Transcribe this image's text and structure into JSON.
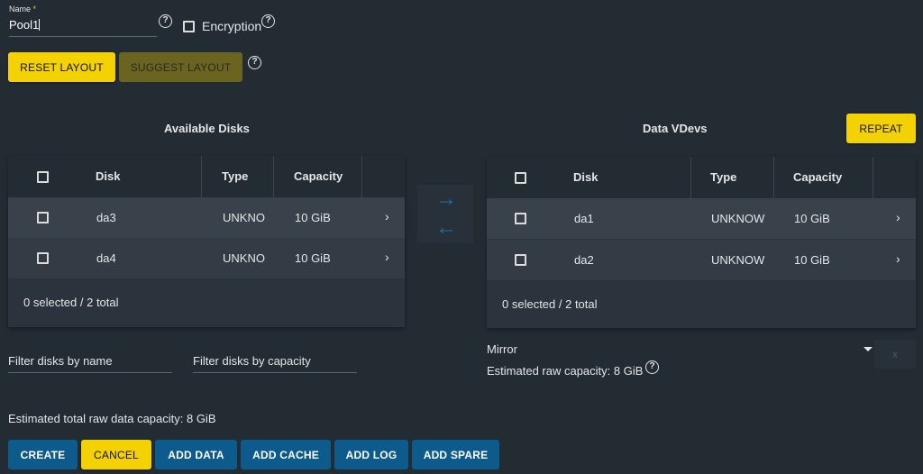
{
  "name_field": {
    "label": "Name",
    "required_mark": "*",
    "value": "Pool1"
  },
  "encryption": {
    "label": "Encryption"
  },
  "help_glyph": "?",
  "layout_buttons": {
    "reset": "RESET LAYOUT",
    "suggest": "SUGGEST LAYOUT"
  },
  "available": {
    "title": "Available Disks",
    "headers": {
      "disk": "Disk",
      "type": "Type",
      "capacity": "Capacity"
    },
    "rows": [
      {
        "disk": "da3",
        "type": "UNKNO",
        "capacity": "10 GiB"
      },
      {
        "disk": "da4",
        "type": "UNKNO",
        "capacity": "10 GiB"
      }
    ],
    "footer": "0 selected / 2 total"
  },
  "vdevs": {
    "title": "Data VDevs",
    "repeat": "REPEAT",
    "headers": {
      "disk": "Disk",
      "type": "Type",
      "capacity": "Capacity"
    },
    "rows": [
      {
        "disk": "da1",
        "type": "UNKNOW",
        "capacity": "10 GiB"
      },
      {
        "disk": "da2",
        "type": "UNKNOW",
        "capacity": "10 GiB"
      }
    ],
    "footer": "0 selected / 2 total",
    "layout_select": "Mirror",
    "raw_capacity": "Estimated raw capacity: 8 GiB",
    "remove_glyph": "x"
  },
  "filters": {
    "by_name": "Filter disks by name",
    "by_capacity": "Filter disks by capacity"
  },
  "total_capacity": "Estimated total raw data capacity: 8 GiB",
  "actions": {
    "create": "CREATE",
    "cancel": "CANCEL",
    "add_data": "ADD DATA",
    "add_cache": "ADD CACHE",
    "add_log": "ADD LOG",
    "add_spare": "ADD SPARE"
  },
  "arrows": {
    "right": "→",
    "left": "←"
  },
  "chevron": "›",
  "colors": {
    "background": "#232b33",
    "yellow": "#f4d100",
    "blue": "#0d5a8c",
    "arrow": "#1f6fa6"
  }
}
